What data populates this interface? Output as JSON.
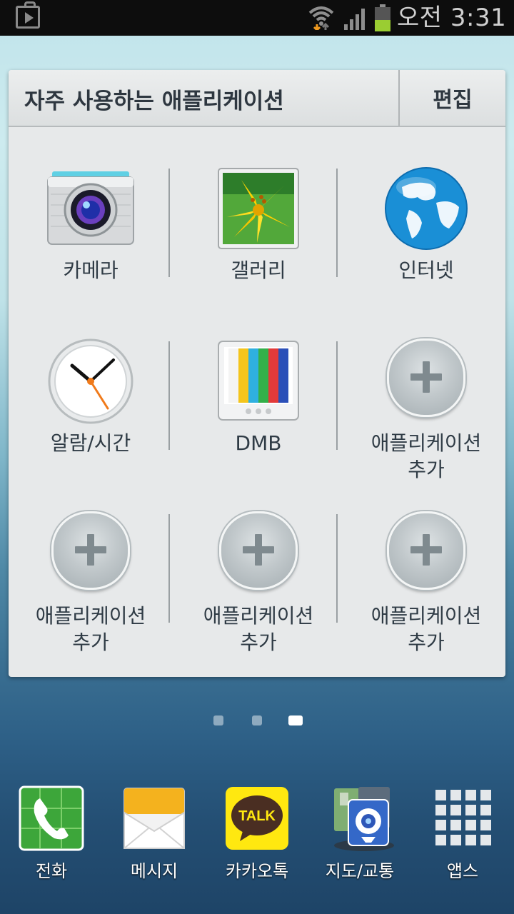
{
  "status_bar": {
    "time": "오전 3:31"
  },
  "widget": {
    "title": "자주 사용하는 애플리케이션",
    "edit_label": "편집",
    "apps": [
      {
        "label_line1": "카메라",
        "label_line2": "",
        "icon": "camera-icon"
      },
      {
        "label_line1": "갤러리",
        "label_line2": "",
        "icon": "gallery-icon"
      },
      {
        "label_line1": "인터넷",
        "label_line2": "",
        "icon": "internet-globe-icon"
      },
      {
        "label_line1": "알람/시간",
        "label_line2": "",
        "icon": "clock-icon"
      },
      {
        "label_line1": "DMB",
        "label_line2": "",
        "icon": "dmb-tv-icon"
      },
      {
        "label_line1": "애플리케이션",
        "label_line2": "추가",
        "icon": "add-icon"
      },
      {
        "label_line1": "애플리케이션",
        "label_line2": "추가",
        "icon": "add-icon"
      },
      {
        "label_line1": "애플리케이션",
        "label_line2": "추가",
        "icon": "add-icon"
      },
      {
        "label_line1": "애플리케이션",
        "label_line2": "추가",
        "icon": "add-icon"
      }
    ]
  },
  "page_indicator": {
    "pages": 3,
    "current": 3
  },
  "dock": [
    {
      "label": "전화",
      "icon": "phone-icon"
    },
    {
      "label": "메시지",
      "icon": "message-icon"
    },
    {
      "label": "카카오톡",
      "icon": "kakaotalk-icon",
      "icon_text": "TALK"
    },
    {
      "label": "지도/교통",
      "icon": "map-icon"
    },
    {
      "label": "앱스",
      "icon": "apps-grid-icon"
    }
  ]
}
